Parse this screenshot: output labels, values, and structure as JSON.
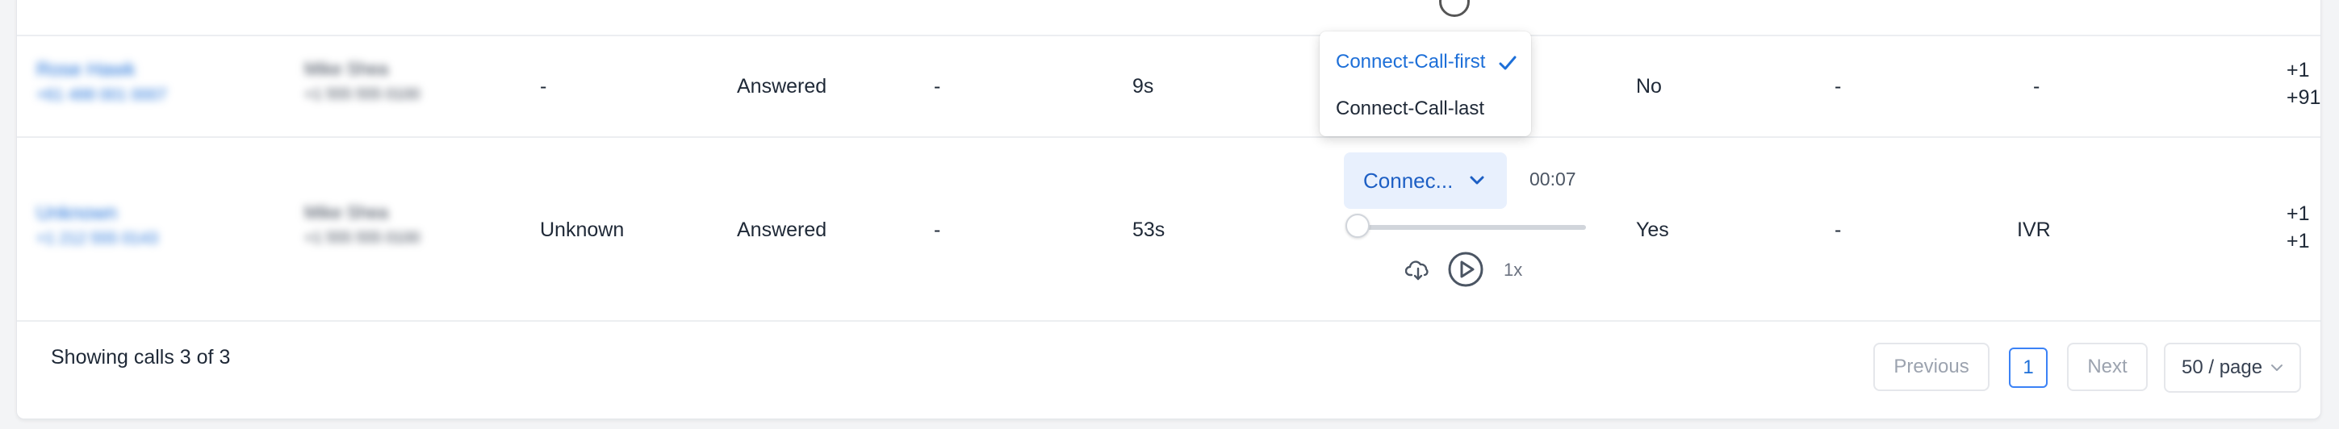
{
  "table": {
    "rows": [
      {
        "contact_name": "Rose Hawk",
        "contact_sub": "+61 488 001 0007",
        "agent_name": "Mike Shea",
        "agent_sub": "+1 555 555 0100",
        "caller_id": "-",
        "status": "Answered",
        "notes": "-",
        "duration": "9s",
        "voicemail": "No",
        "tags": "-",
        "source": "-",
        "phone_lines": [
          "+1",
          "+91"
        ]
      },
      {
        "contact_name": "Unknown",
        "contact_sub": "+1 212 555 0143",
        "agent_name": "Mike Shea",
        "agent_sub": "+1 555 555 0100",
        "caller_id": "Unknown",
        "status": "Answered",
        "notes": "-",
        "duration": "53s",
        "voicemail": "Yes",
        "tags": "-",
        "source": "IVR",
        "phone_lines": [
          "+1",
          "+1"
        ]
      }
    ]
  },
  "recording": {
    "selected_label": "Connec...",
    "time": "00:07",
    "speed": "1x",
    "progress_fraction": 0.0,
    "options": [
      {
        "label": "Connect-Call-first",
        "selected": true
      },
      {
        "label": "Connect-Call-last",
        "selected": false
      }
    ]
  },
  "footer": {
    "summary": "Showing calls 3 of 3",
    "previous_label": "Previous",
    "current_page": "1",
    "next_label": "Next",
    "page_size_label": "50 / page"
  },
  "colors": {
    "accent": "#1d6fd8",
    "select_bg": "#e8f0fd"
  }
}
